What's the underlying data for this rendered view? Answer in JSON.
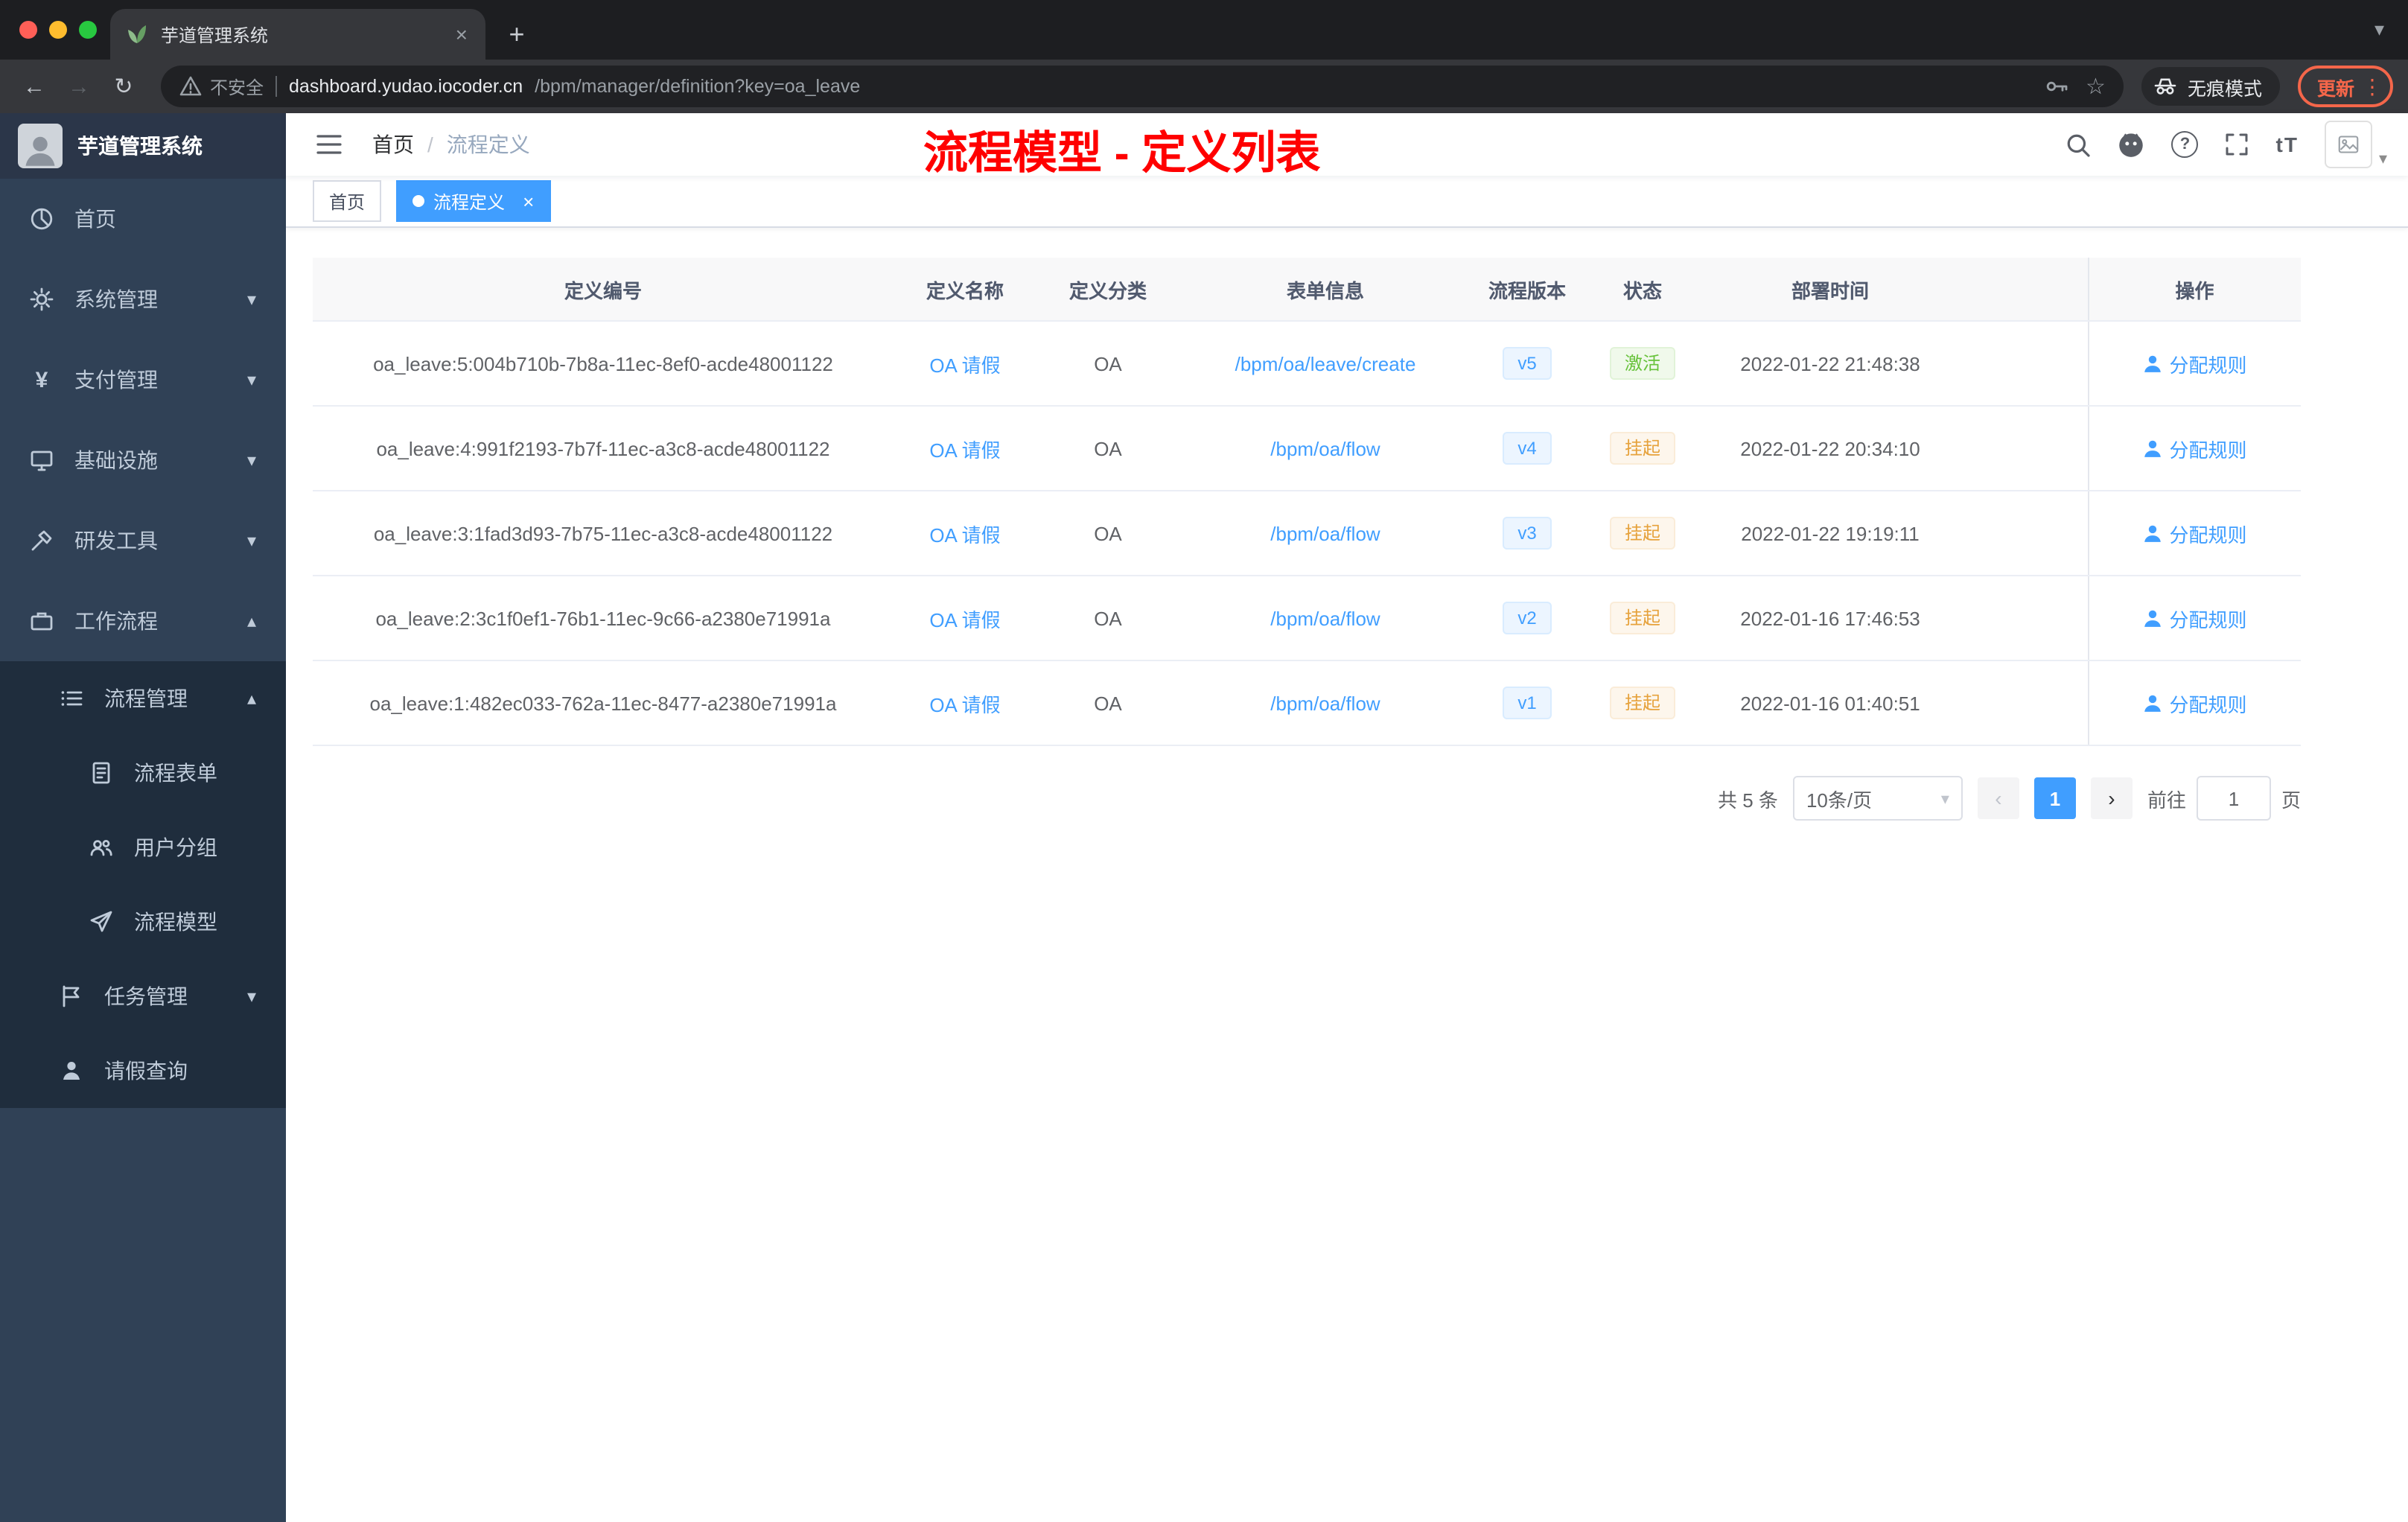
{
  "browser": {
    "tab_title": "芋道管理系统",
    "address": {
      "warning_label": "不安全",
      "host": "dashboard.yudao.iocoder.cn",
      "path": "/bpm/manager/definition?key=oa_leave"
    },
    "incognito_label": "无痕模式",
    "update_label": "更新"
  },
  "icons": {
    "back": "←",
    "forward": "→",
    "reload": "↻",
    "star": "☆",
    "dots": "⋮",
    "plus": "+",
    "close": "×",
    "chevron_down": "▾",
    "chevron_up": "▴",
    "question": "?",
    "font_size": "tT",
    "prev": "‹",
    "next": "›"
  },
  "sidebar": {
    "logo_title": "芋道管理系统",
    "menu": [
      {
        "label": "首页"
      },
      {
        "label": "系统管理"
      },
      {
        "label": "支付管理"
      },
      {
        "label": "基础设施"
      },
      {
        "label": "研发工具"
      },
      {
        "label": "工作流程"
      }
    ],
    "workflow_submenu": [
      {
        "label": "流程管理",
        "children": [
          {
            "label": "流程表单"
          },
          {
            "label": "用户分组"
          },
          {
            "label": "流程模型"
          }
        ]
      },
      {
        "label": "任务管理"
      },
      {
        "label": "请假查询"
      }
    ]
  },
  "header": {
    "breadcrumb_home": "首页",
    "breadcrumb_sep": "/",
    "breadcrumb_current": "流程定义",
    "annotation": "流程模型 - 定义列表"
  },
  "tags": {
    "home": "首页",
    "active": "流程定义"
  },
  "table": {
    "columns": [
      "定义编号",
      "定义名称",
      "定义分类",
      "表单信息",
      "流程版本",
      "状态",
      "部署时间",
      "操作"
    ],
    "rows": [
      {
        "id": "oa_leave:5:004b710b-7b8a-11ec-8ef0-acde48001122",
        "name": "OA 请假",
        "category": "OA",
        "form": "/bpm/oa/leave/create",
        "version": "v5",
        "status": "激活",
        "time": "2022-01-22 21:48:38",
        "action": "分配规则"
      },
      {
        "id": "oa_leave:4:991f2193-7b7f-11ec-a3c8-acde48001122",
        "name": "OA 请假",
        "category": "OA",
        "form": "/bpm/oa/flow",
        "version": "v4",
        "status": "挂起",
        "time": "2022-01-22 20:34:10",
        "action": "分配规则"
      },
      {
        "id": "oa_leave:3:1fad3d93-7b75-11ec-a3c8-acde48001122",
        "name": "OA 请假",
        "category": "OA",
        "form": "/bpm/oa/flow",
        "version": "v3",
        "status": "挂起",
        "time": "2022-01-22 19:19:11",
        "action": "分配规则"
      },
      {
        "id": "oa_leave:2:3c1f0ef1-76b1-11ec-9c66-a2380e71991a",
        "name": "OA 请假",
        "category": "OA",
        "form": "/bpm/oa/flow",
        "version": "v2",
        "status": "挂起",
        "time": "2022-01-16 17:46:53",
        "action": "分配规则"
      },
      {
        "id": "oa_leave:1:482ec033-762a-11ec-8477-a2380e71991a",
        "name": "OA 请假",
        "category": "OA",
        "form": "/bpm/oa/flow",
        "version": "v1",
        "status": "挂起",
        "time": "2022-01-16 01:40:51",
        "action": "分配规则"
      }
    ]
  },
  "pagination": {
    "total": "共 5 条",
    "page_size": "10条/页",
    "page": "1",
    "goto_label": "前往",
    "goto_value": "1",
    "goto_unit": "页"
  },
  "colors": {
    "primary": "#409eff",
    "annotation_red": "#ff0000",
    "status_active_text": "#67c23a",
    "status_active_bg": "#f0f9eb",
    "status_suspend_text": "#e6a23c",
    "status_suspend_bg": "#fdf6ec",
    "version_tag_text": "#409eff",
    "version_tag_bg": "#ecf5ff",
    "sidebar_bg": "#304156",
    "submenu_bg": "#1f2d3d",
    "update_accent": "#f4664a"
  }
}
